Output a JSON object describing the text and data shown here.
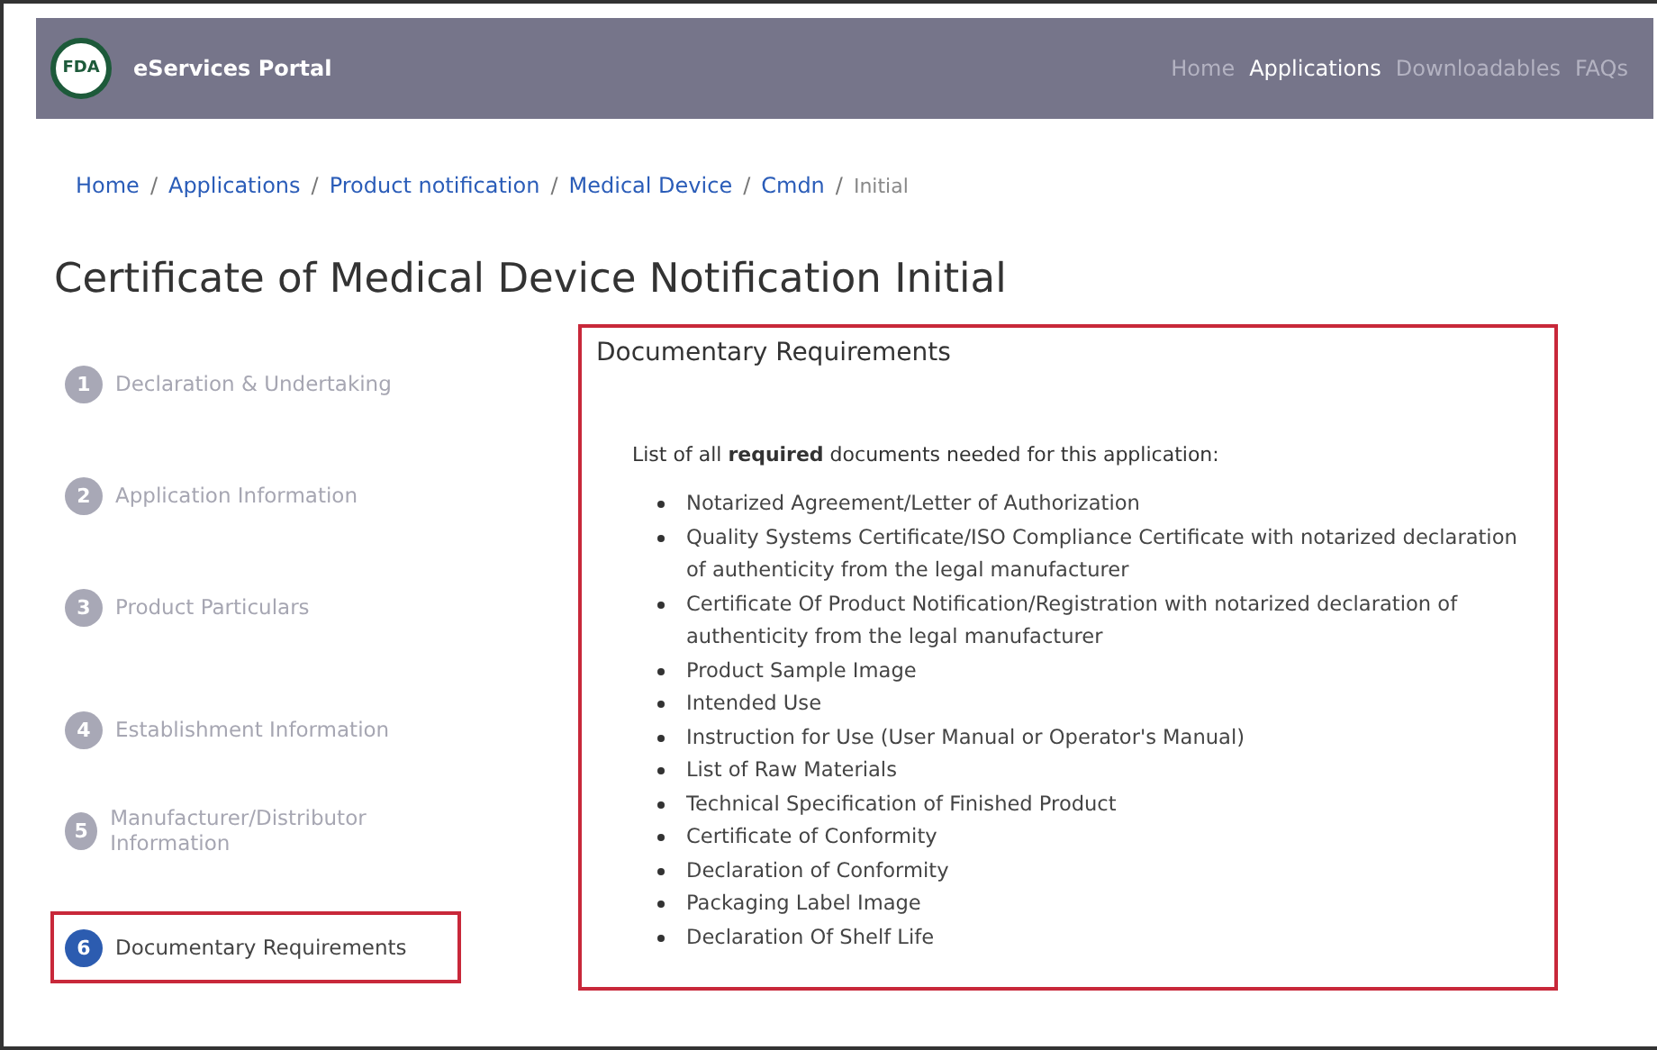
{
  "navbar": {
    "logo_text": "FDA",
    "title": "eServices Portal",
    "links": [
      {
        "label": "Home",
        "selected": false
      },
      {
        "label": "Applications",
        "selected": true
      },
      {
        "label": "Downloadables",
        "selected": false
      },
      {
        "label": "FAQs",
        "selected": false
      }
    ]
  },
  "breadcrumb": [
    {
      "kind": "link",
      "label": "Home"
    },
    {
      "kind": "separator",
      "label": "/"
    },
    {
      "kind": "link",
      "label": "Applications"
    },
    {
      "kind": "separator",
      "label": "/"
    },
    {
      "kind": "link",
      "label": "Product notification"
    },
    {
      "kind": "separator",
      "label": "/"
    },
    {
      "kind": "link",
      "label": "Medical Device"
    },
    {
      "kind": "separator",
      "label": "/"
    },
    {
      "kind": "link",
      "label": "Cmdn"
    },
    {
      "kind": "separator",
      "label": "/"
    },
    {
      "kind": "current",
      "label": "Initial"
    }
  ],
  "page_title": "Certificate of Medical Device Notification Initial",
  "steps": [
    {
      "number": "1",
      "label": "Declaration & Undertaking",
      "selected": false
    },
    {
      "number": "2",
      "label": "Application Information",
      "selected": false
    },
    {
      "number": "3",
      "label": "Product Particulars",
      "selected": false
    },
    {
      "number": "4",
      "label": "Establishment Information",
      "selected": false
    },
    {
      "number": "5",
      "label": "Manufacturer/Distributor Information",
      "selected": false
    },
    {
      "number": "6",
      "label": "Documentary Requirements",
      "selected": true
    }
  ],
  "panel": {
    "title": "Documentary Requirements",
    "intro": "List of all **required** documents needed for this application:",
    "items": [
      "Notarized Agreement/Letter of Authorization",
      "Quality Systems Certificate/ISO Compliance Certificate with notarized declaration of authenticity from the legal manufacturer",
      "Certificate Of Product Notification/Registration with notarized declaration of authenticity from the legal manufacturer",
      "Product Sample Image",
      "Intended Use",
      "Instruction for Use (User Manual or Operator's Manual)",
      "List of Raw Materials",
      "Technical Specification of Finished Product",
      "Certificate of Conformity",
      "Declaration of Conformity",
      "Packaging Label Image",
      "Declaration Of Shelf Life"
    ]
  }
}
